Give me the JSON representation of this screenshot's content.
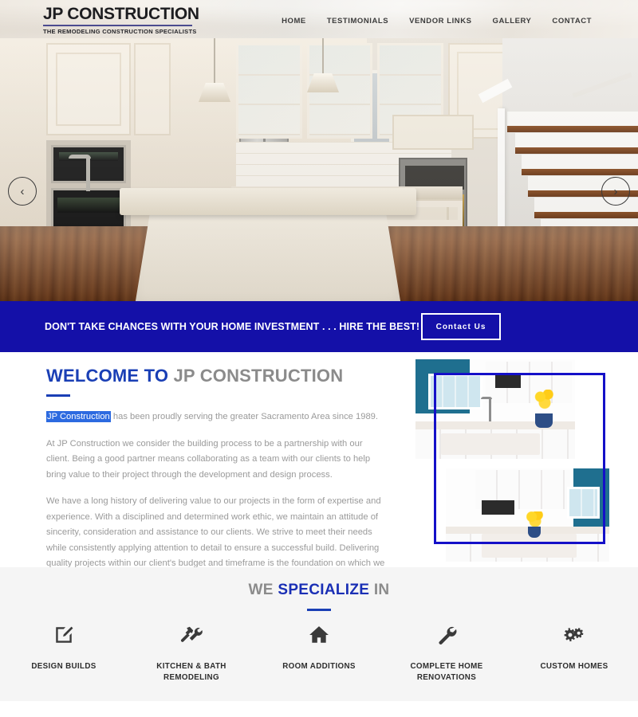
{
  "header": {
    "logo_main": "JP CONSTRUCTION",
    "logo_tagline": "THE REMODELING CONSTRUCTION SPECIALISTS",
    "nav": [
      {
        "label": "HOME"
      },
      {
        "label": "TESTIMONIALS"
      },
      {
        "label": "VENDOR LINKS"
      },
      {
        "label": "GALLERY"
      },
      {
        "label": "CONTACT"
      }
    ]
  },
  "hero": {
    "prev_icon": "chevron-left-icon",
    "next_icon": "chevron-right-icon",
    "prev_glyph": "‹",
    "next_glyph": "›"
  },
  "cta": {
    "text": "DON'T TAKE CHANCES WITH YOUR HOME INVESTMENT . . . HIRE THE BEST!",
    "button_label": "Contact Us",
    "background_color": "#1410a8"
  },
  "welcome": {
    "heading_accent": "WELCOME TO",
    "heading_rest": "JP CONSTRUCTION",
    "paragraph1_highlighted": "JP Construction",
    "paragraph1_rest": " has been proudly serving the greater Sacramento Area since 1989.",
    "paragraph2": "At JP Construction we consider the building process to be a partnership with our client. Being a good partner means collaborating as a team with our clients to help bring value to their project through the development and design process.",
    "paragraph3": "We have a long history of delivering value to our projects in the form of expertise and experience. With a disciplined and determined work ethic, we maintain an attitude of sincerity, consideration and assistance to our clients. We strive to meet their needs while consistently applying attention to detail to ensure a successful build. Delivering quality projects within our client's budget and timeframe is the foundation on which we have built our reputation.",
    "accent_color": "#1a3fb5",
    "selection_color": "#2c6ae0",
    "frame_color": "#1410c8"
  },
  "specialize": {
    "heading_part1": "WE ",
    "heading_accent": "SPECIALIZE",
    "heading_part2": " IN",
    "items": [
      {
        "label": "DESIGN BUILDS",
        "icon": "pencil-square-icon"
      },
      {
        "label": "KITCHEN & BATH REMODELING",
        "icon": "hammer-wrench-icon"
      },
      {
        "label": "ROOM ADDITIONS",
        "icon": "home-icon"
      },
      {
        "label": "COMPLETE HOME RENOVATIONS",
        "icon": "wrench-icon"
      },
      {
        "label": "CUSTOM HOMES",
        "icon": "cogs-icon"
      }
    ]
  }
}
